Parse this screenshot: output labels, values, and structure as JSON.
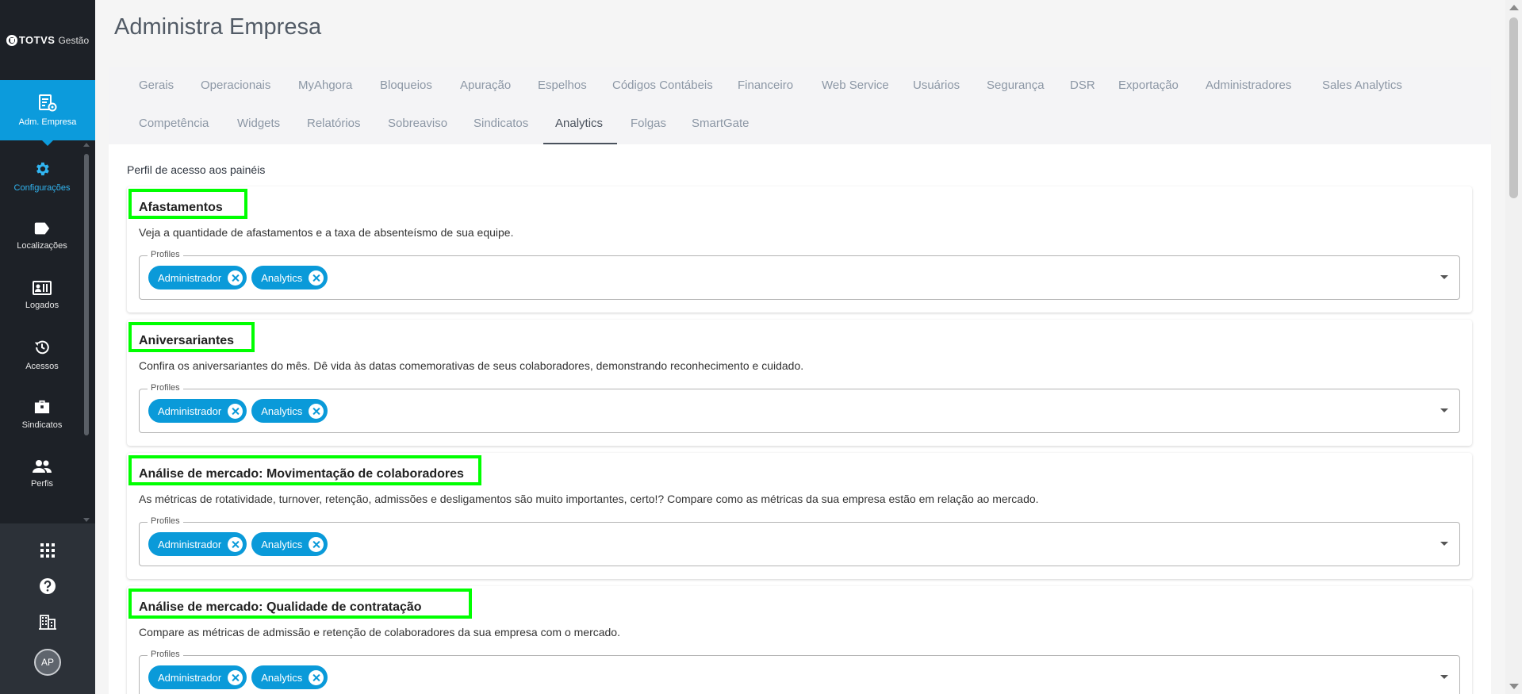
{
  "app": {
    "logo_brand": "TOTVS",
    "logo_suffix": "Gestão",
    "page_title": "Administra Empresa"
  },
  "sidebar": {
    "active_label": "Adm. Empresa",
    "items": [
      {
        "label": "Configurações",
        "icon": "gear-icon"
      },
      {
        "label": "Localizações",
        "icon": "tag-icon"
      },
      {
        "label": "Logados",
        "icon": "badge-icon"
      },
      {
        "label": "Acessos",
        "icon": "history-icon"
      },
      {
        "label": "Sindicatos",
        "icon": "briefcase-icon"
      },
      {
        "label": "Perfis",
        "icon": "people-icon"
      }
    ],
    "avatar_initials": "AP"
  },
  "tabs": [
    "Gerais",
    "Operacionais",
    "MyAhgora",
    "Bloqueios",
    "Apuração",
    "Espelhos",
    "Códigos Contábeis",
    "Financeiro",
    "Web Service",
    "Usuários",
    "Segurança",
    "DSR",
    "Exportação",
    "Administradores",
    "Sales Analytics",
    "Competência",
    "Widgets",
    "Relatórios",
    "Sobreaviso",
    "Sindicatos",
    "Analytics",
    "Folgas",
    "SmartGate"
  ],
  "active_tab": "Analytics",
  "section_title": "Perfil de acesso aos painéis",
  "profiles_label": "Profiles",
  "cards": [
    {
      "title": "Afastamentos",
      "description": "Veja a quantidade de afastamentos e a taxa de absenteísmo de sua equipe.",
      "profiles": [
        "Administrador",
        "Analytics"
      ]
    },
    {
      "title": "Aniversariantes",
      "description": "Confira os aniversariantes do mês. Dê vida às datas comemorativas de seus colaboradores, demonstrando reconhecimento e cuidado.",
      "profiles": [
        "Administrador",
        "Analytics"
      ]
    },
    {
      "title": "Análise de mercado: Movimentação de colaboradores",
      "description": "As métricas de rotatividade, turnover, retenção, admissões e desligamentos são muito importantes, certo!? Compare como as métricas da sua empresa estão em relação ao mercado.",
      "profiles": [
        "Administrador",
        "Analytics"
      ]
    },
    {
      "title": "Análise de mercado: Qualidade de contratação",
      "description": "Compare as métricas de admissão e retenção de colaboradores da sua empresa com o mercado.",
      "profiles": [
        "Administrador",
        "Analytics"
      ]
    }
  ],
  "colors": {
    "accent": "#0c9bdc",
    "chip": "#0a9ad9",
    "highlight": "#00ff00",
    "sidebar": "#1d2127"
  }
}
